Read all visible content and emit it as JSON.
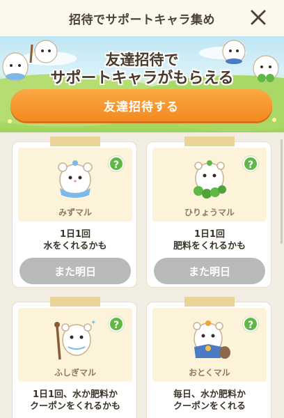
{
  "header": {
    "title": "招待でサポートキャラ集め",
    "close_icon": "close-icon"
  },
  "banner": {
    "line1": "友達招待で",
    "line2": "サポートキャラがもらえる",
    "invite_button": "友達招待する"
  },
  "cards": [
    {
      "name": "みずマル",
      "desc_line1": "1日1回",
      "desc_line2": "水をくれるかも",
      "button": "また明日",
      "help": "?",
      "icon": "water-hamster-icon"
    },
    {
      "name": "ひりょうマル",
      "desc_line1": "1日1回",
      "desc_line2": "肥料をくれるかも",
      "button": "また明日",
      "help": "?",
      "icon": "clover-hamster-icon"
    },
    {
      "name": "ふしぎマル",
      "desc_line1": "1日1回、水か肥料か",
      "desc_line2": "クーポンをくれるかも",
      "help": "?",
      "icon": "wizard-hamster-icon"
    },
    {
      "name": "おとくマル",
      "desc_line1": "毎日、水か肥料か",
      "desc_line2": "クーポンをくれる",
      "help": "?",
      "icon": "merchant-hamster-icon"
    }
  ],
  "colors": {
    "accent_orange": "#f38a1f",
    "help_green": "#5fb745",
    "disabled_gray": "#b9b9b9"
  }
}
